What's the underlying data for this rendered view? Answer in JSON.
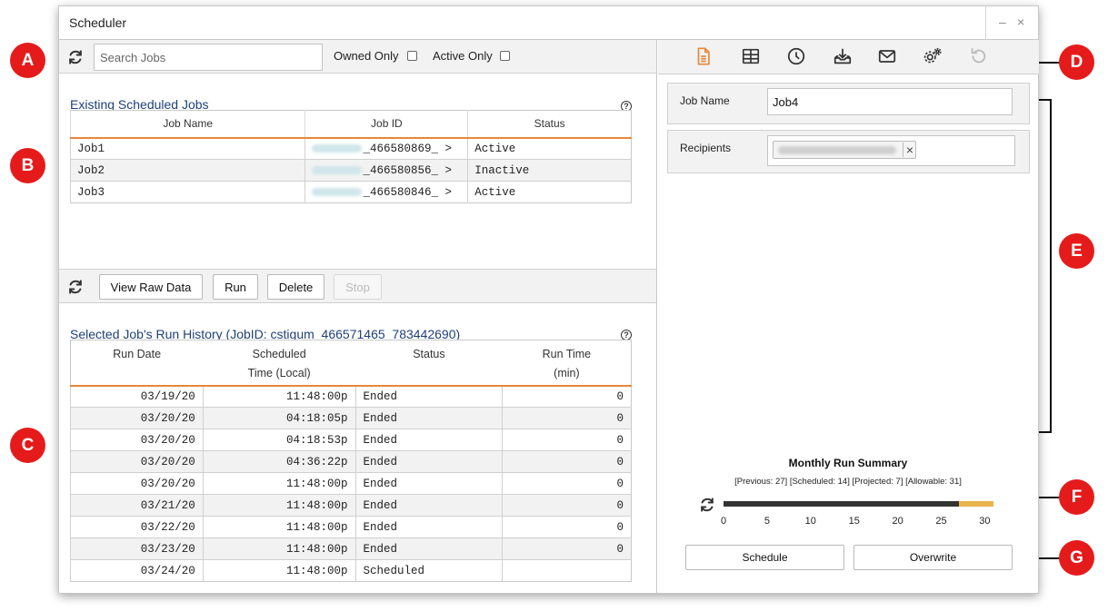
{
  "window": {
    "title": "Scheduler",
    "minimize": "–",
    "close": "×"
  },
  "search": {
    "placeholder": "Search Jobs",
    "owned_only": "Owned Only",
    "active_only": "Active Only"
  },
  "jobs_section": {
    "title": "Existing Scheduled Jobs",
    "help": "?",
    "columns": [
      "Job Name",
      "Job ID",
      "Status"
    ],
    "rows": [
      {
        "name": "Job1",
        "id": "_466580869_ >",
        "status": "Active"
      },
      {
        "name": "Job2",
        "id": "_466580856_ >",
        "status": "Inactive"
      },
      {
        "name": "Job3",
        "id": "_466580846_ >",
        "status": "Active"
      }
    ]
  },
  "actions": {
    "view_raw": "View Raw Data",
    "run": "Run",
    "delete": "Delete",
    "stop": "Stop"
  },
  "history_section": {
    "title": "Selected Job's Run History (JobID: cstigum_466571465_783442690)",
    "help": "?",
    "columns": {
      "run_date": "Run Date",
      "scheduled_1": "Scheduled",
      "scheduled_2": "Time (Local)",
      "status": "Status",
      "runtime_1": "Run Time",
      "runtime_2": "(min)"
    },
    "rows": [
      {
        "date": "03/19/20",
        "time": "11:48:00p",
        "status": "Ended",
        "runtime": "0"
      },
      {
        "date": "03/20/20",
        "time": "04:18:05p",
        "status": "Ended",
        "runtime": "0"
      },
      {
        "date": "03/20/20",
        "time": "04:18:53p",
        "status": "Ended",
        "runtime": "0"
      },
      {
        "date": "03/20/20",
        "time": "04:36:22p",
        "status": "Ended",
        "runtime": "0"
      },
      {
        "date": "03/20/20",
        "time": "11:48:00p",
        "status": "Ended",
        "runtime": "0"
      },
      {
        "date": "03/21/20",
        "time": "11:48:00p",
        "status": "Ended",
        "runtime": "0"
      },
      {
        "date": "03/22/20",
        "time": "11:48:00p",
        "status": "Ended",
        "runtime": "0"
      },
      {
        "date": "03/23/20",
        "time": "11:48:00p",
        "status": "Ended",
        "runtime": "0"
      },
      {
        "date": "03/24/20",
        "time": "11:48:00p",
        "status": "Scheduled",
        "runtime": ""
      }
    ]
  },
  "toolbar_icons": [
    "document-icon",
    "table-icon",
    "clock-icon",
    "download-tray-icon",
    "mail-icon",
    "gears-icon",
    "undo-icon"
  ],
  "job_form": {
    "name_label": "Job Name",
    "name_value": "Job4",
    "recipients_label": "Recipients",
    "chip_remove": "×"
  },
  "summary": {
    "title": "Monthly Run Summary",
    "detail": "[Previous: 27] [Scheduled: 14] [Projected: 7] [Allowable: 31]",
    "progress_value": 27,
    "progress_max": 31,
    "axis_ticks": [
      "0",
      "5",
      "10",
      "15",
      "20",
      "25",
      "30"
    ]
  },
  "bottom_buttons": {
    "schedule": "Schedule",
    "overwrite": "Overwrite"
  },
  "annotations": [
    "A",
    "B",
    "C",
    "D",
    "E",
    "F",
    "G"
  ],
  "colors": {
    "accent_orange": "#e8863a",
    "marker_red": "#e51b1b",
    "title_blue": "#1f3f7a",
    "active_green": "#1f7a1f",
    "job_id_teal": "#1d8a95",
    "progress_dark": "#333333",
    "progress_remaining": "#e8b44d"
  }
}
